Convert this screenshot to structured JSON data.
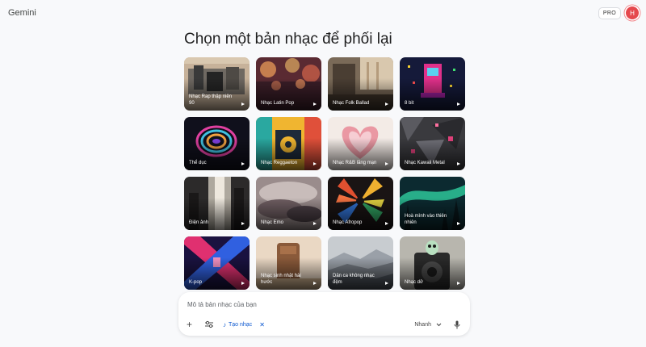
{
  "app": {
    "name": "Gemini"
  },
  "header": {
    "pro_label": "PRO",
    "avatar_initial": "H"
  },
  "page": {
    "heading": "Chọn một bản nhạc để phối lại"
  },
  "cards": [
    {
      "label": "Nhạc Rap thập niên 90",
      "art": "rap-90s"
    },
    {
      "label": "Nhạc Latin Pop",
      "art": "latin-pop"
    },
    {
      "label": "Nhạc Folk Ballad",
      "art": "folk-ballad"
    },
    {
      "label": "8 bit",
      "art": "arcade-8bit"
    },
    {
      "label": "Thể dục",
      "art": "workout-swirl"
    },
    {
      "label": "Nhạc Reggaeton",
      "art": "reggaeton"
    },
    {
      "label": "Nhạc R&B lãng mạn",
      "art": "heart-hands"
    },
    {
      "label": "Nhạc Kawaii Metal",
      "art": "kawaii-metal"
    },
    {
      "label": "Điện ảnh",
      "art": "cinematic"
    },
    {
      "label": "Nhạc Emo",
      "art": "emo"
    },
    {
      "label": "Nhạc Afropop",
      "art": "afropop"
    },
    {
      "label": "Hoà mình vào thiên nhiên",
      "art": "aurora"
    },
    {
      "label": "K-pop",
      "art": "kpop"
    },
    {
      "label": "Nhạc sinh nhật hài hước",
      "art": "birthday"
    },
    {
      "label": "Dân ca không nhạc đệm",
      "art": "misty-mountains"
    },
    {
      "label": "Nhạc dở",
      "art": "owl-speaker"
    }
  ],
  "composer": {
    "placeholder": "Mô tả bản nhạc của bạn",
    "chip_label": "Tạo nhạc",
    "speed_label": "Nhanh"
  },
  "colors": {
    "accent": "#0b57d0",
    "avatar": "#e5484d",
    "background": "#f8f9fb"
  }
}
